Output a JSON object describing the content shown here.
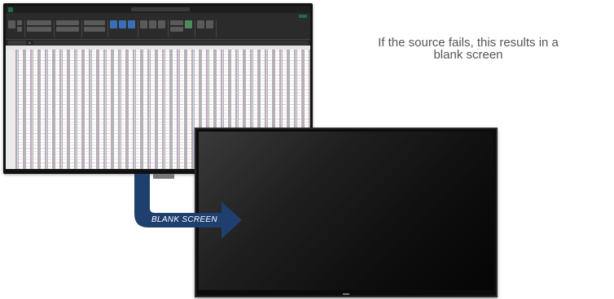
{
  "caption": {
    "line1": "If the source fails, this results in a",
    "line2": "blank screen"
  },
  "arrow": {
    "label": "BLANK SCREEN",
    "color": "#1f3f6e"
  },
  "spreadsheet": {
    "app_icon": "excel-icon",
    "accent_color": "#1d6f42"
  },
  "tv": {
    "state": "off"
  }
}
